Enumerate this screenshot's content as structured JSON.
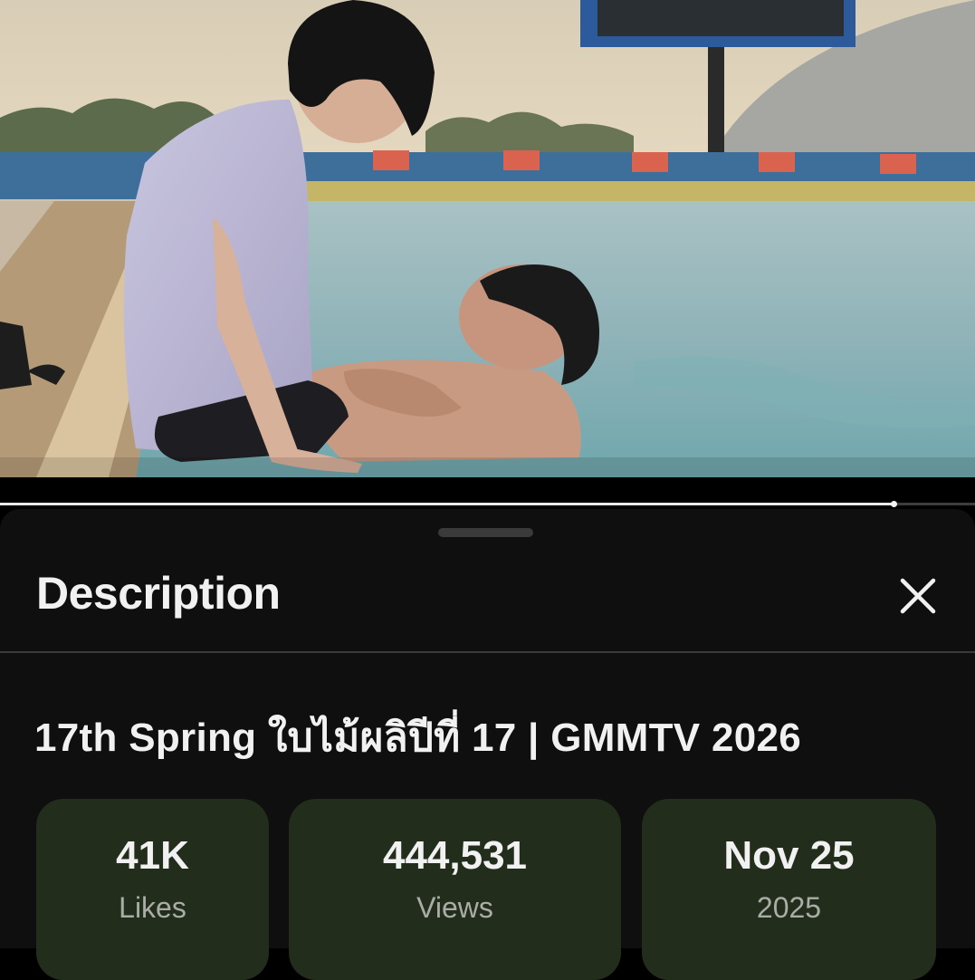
{
  "player": {
    "progress_fraction": 0.916
  },
  "sheet": {
    "title": "Description",
    "close_icon": "close-icon"
  },
  "video": {
    "title": "17th Spring ใบไม้ผลิปีที่ 17 | GMMTV 2026"
  },
  "stats": {
    "likes": {
      "value": "41K",
      "label": "Likes"
    },
    "views": {
      "value": "444,531",
      "label": "Views"
    },
    "date": {
      "value": "Nov 25",
      "label": "2025"
    }
  },
  "colors": {
    "sheet_background": "#0f0f0f",
    "stat_card_background": "#232d1c",
    "primary_text": "#f1f1f1",
    "secondary_text": "#a9ada6"
  }
}
